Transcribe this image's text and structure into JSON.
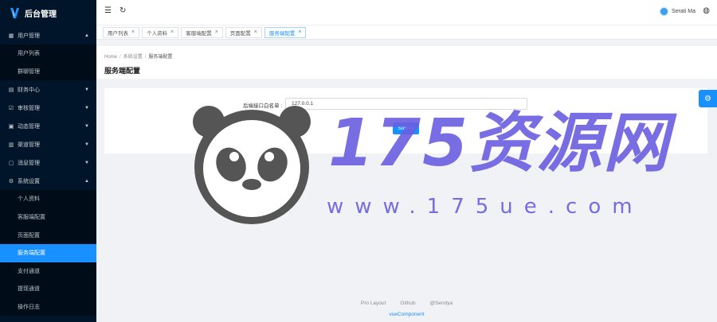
{
  "app": {
    "title": "后台管理"
  },
  "sidebar": {
    "groups": [
      {
        "label": "用户管理",
        "icon": "grid-icon",
        "open": true,
        "items": [
          "用户列表",
          "群聊管理"
        ]
      },
      {
        "label": "财务中心",
        "icon": "document-icon",
        "open": false,
        "items": []
      },
      {
        "label": "审核管理",
        "icon": "check-icon",
        "open": false,
        "items": []
      },
      {
        "label": "动态管理",
        "icon": "picture-icon",
        "open": false,
        "items": []
      },
      {
        "label": "渠道管理",
        "icon": "link-icon",
        "open": false,
        "items": []
      },
      {
        "label": "消息管理",
        "icon": "message-icon",
        "open": false,
        "items": []
      },
      {
        "label": "系统设置",
        "icon": "gear-icon",
        "open": true,
        "items": [
          "个人资料",
          "客服端配置",
          "页面配置",
          "服务端配置",
          "支付通道",
          "提现通道",
          "操作日志"
        ]
      }
    ],
    "active_item": "服务端配置"
  },
  "header": {
    "menu_icon": "☰",
    "refresh_icon": "↻",
    "user_name": "Serati Ma",
    "globe_icon": "◍"
  },
  "tabs": [
    {
      "label": "用户列表",
      "active": false
    },
    {
      "label": "个人资料",
      "active": false
    },
    {
      "label": "客服端配置",
      "active": false
    },
    {
      "label": "页面配置",
      "active": false
    },
    {
      "label": "服务端配置",
      "active": true
    }
  ],
  "breadcrumb": {
    "items": [
      "Home",
      "系统设置",
      "服务端配置"
    ]
  },
  "page": {
    "title": "服务端配置",
    "form": {
      "label": "后端接口白名单 :",
      "value": "127.0.0.1",
      "submit_label": "Submit"
    }
  },
  "footer": {
    "links": [
      "Pro Layout",
      "Github",
      "@Sendya"
    ],
    "copyright": "vueComponent"
  },
  "watermark": {
    "main": "175资源网",
    "sub": "www.175ue.com"
  },
  "colors": {
    "sidebar_bg": "#001529",
    "primary": "#1890ff",
    "watermark": "#6b5ee0"
  }
}
